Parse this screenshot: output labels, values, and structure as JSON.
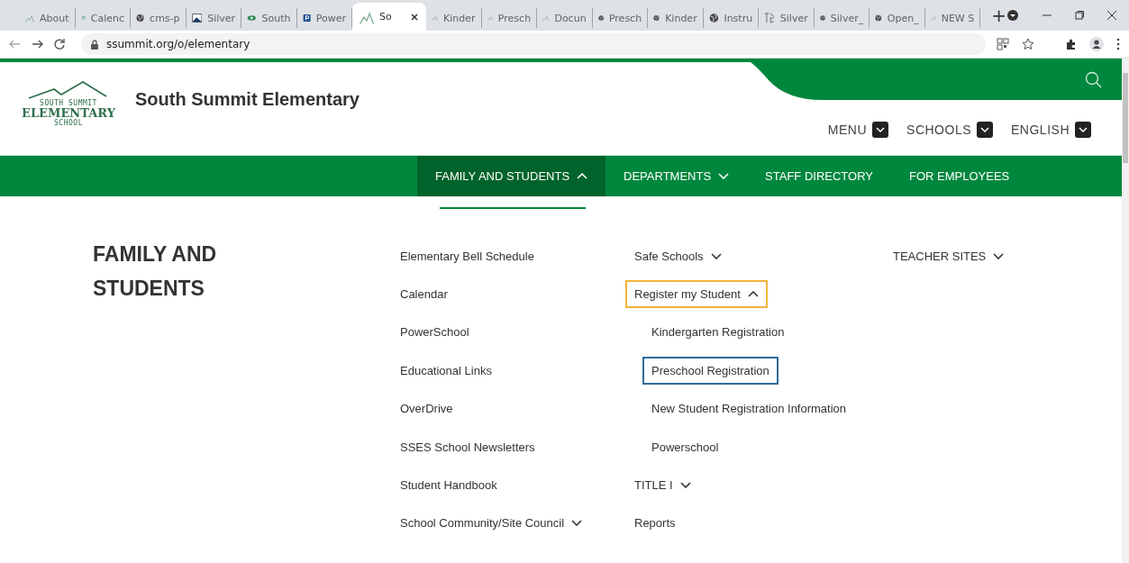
{
  "browser": {
    "tabs": [
      {
        "title": "About",
        "kind": "mountain",
        "selected": false
      },
      {
        "title": "Calenc",
        "kind": "people",
        "selected": false
      },
      {
        "title": "cms-p",
        "kind": "globe",
        "selected": false
      },
      {
        "title": "Silver",
        "kind": "image",
        "selected": false
      },
      {
        "title": "South",
        "kind": "leaf",
        "selected": false
      },
      {
        "title": "Power",
        "kind": "letter",
        "selected": false
      },
      {
        "title": "So",
        "kind": "mountain",
        "selected": true
      },
      {
        "title": "Kinder",
        "kind": "mountain",
        "selected": false
      },
      {
        "title": "Presch",
        "kind": "mountain",
        "selected": false
      },
      {
        "title": "Docun",
        "kind": "mountain",
        "selected": false
      },
      {
        "title": "Presch",
        "kind": "globe",
        "selected": false
      },
      {
        "title": "Kinder",
        "kind": "globe",
        "selected": false
      },
      {
        "title": "Instru",
        "kind": "globe",
        "selected": false
      },
      {
        "title": "Silver",
        "kind": "glyph",
        "selected": false
      },
      {
        "title": "Silver_",
        "kind": "globe",
        "selected": false
      },
      {
        "title": "Open_",
        "kind": "globe",
        "selected": false
      },
      {
        "title": "NEW S",
        "kind": "mountain",
        "selected": false
      }
    ],
    "new_tab": "+",
    "url": "ssummit.org/o/elementary"
  },
  "site": {
    "logo": {
      "line_1": "SOUTH SUMMIT",
      "line_2": "ELEMENTARY",
      "line_3": "SCHOOL"
    },
    "title": "South Summit Elementary",
    "utility_links": [
      "MENU",
      "SCHOOLS",
      "ENGLISH"
    ],
    "nav": [
      {
        "label": "FAMILY AND STUDENTS",
        "expanded": true,
        "selected": true
      },
      {
        "label": "DEPARTMENTS",
        "expanded": false,
        "selected": false
      },
      {
        "label": "STAFF DIRECTORY",
        "selected": false
      },
      {
        "label": "FOR EMPLOYEES",
        "selected": false
      }
    ]
  },
  "menu": {
    "heading": "FAMILY AND STUDENTS",
    "columns": [
      [
        {
          "label": "Elementary Bell Schedule"
        },
        {
          "label": "Calendar"
        },
        {
          "label": "PowerSchool"
        },
        {
          "label": "Educational Links"
        },
        {
          "label": "OverDrive"
        },
        {
          "label": "SSES School Newsletters"
        },
        {
          "label": "Student Handbook"
        },
        {
          "label": "School Community/Site Council",
          "expanded": false
        }
      ],
      [
        {
          "label": "Safe Schools",
          "expanded": false
        },
        {
          "label": "Register my Student",
          "expanded": true,
          "outlined": true,
          "children": [
            {
              "label": "Kindergarten Registration",
              "outlined": false
            },
            {
              "label": "Preschool Registration",
              "outlined": true
            },
            {
              "label": "New Student Registration Information",
              "outlined": false
            },
            {
              "label": "Powerschool",
              "outlined": false
            }
          ]
        },
        {
          "label": "TITLE I",
          "expanded": false
        },
        {
          "label": "Reports"
        }
      ],
      [
        {
          "label": "TEACHER SITES",
          "expanded": false
        }
      ]
    ]
  }
}
